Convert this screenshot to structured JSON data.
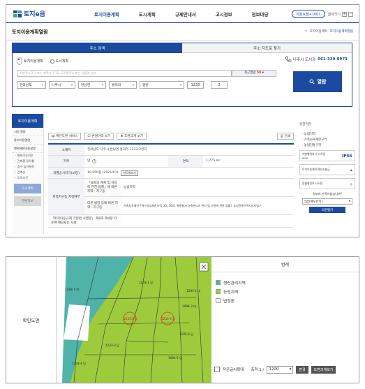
{
  "header": {
    "logo": "토지e음",
    "nav": [
      "토지이용계획",
      "도시계획",
      "규제안내서",
      "고시정보",
      "정보마당"
    ],
    "guide_pill": "지원요청+100?",
    "font_label": "글자크기",
    "plus": "+",
    "minus": "-"
  },
  "title": "토지이용계획열람",
  "breadcrumb": [
    "⌂",
    "토지이용계획",
    "토지이용계획열람"
  ],
  "search": {
    "tabs": [
      "주소 검색",
      "주소 지도로 찾기"
    ],
    "radios": [
      "토지이용계획",
      "도시계획"
    ],
    "phone_label": "나주시 도시과",
    "phone_number": "061-339-8973",
    "address_placeholder": "지번주소 1-1 또는 제주시 1-11, 도로명주소 또는 건물명 입력",
    "recent_label": "최근열람",
    "recent_badge": "58",
    "selects": [
      "전라남도",
      "나주시",
      "반남면",
      "흥덕리",
      "일반"
    ],
    "bon": "1233",
    "bu": "2",
    "dash": "-",
    "view_button": "열람"
  },
  "left_menu": {
    "head": "토지이용계획",
    "items": [
      "시험 열람",
      "통지이용열람",
      "행위제한내용설명"
    ],
    "sub_items": [
      "· 행위가능여부",
      "· 건폐율·용적률",
      "· 층수·높이제한",
      "· 건축선",
      "· 도로조건"
    ],
    "blue_button": "도시계획",
    "gray_button": "관련정보"
  },
  "content": {
    "buttons": [
      "확인도면 서비스",
      "변경이력 보기",
      "도면크게 보기"
    ],
    "print": "인쇄",
    "rows": {
      "location_label": "소재지",
      "location_value": "전라남도 나주시 반남면 흥덕리 1233-2번지",
      "jimok_label": "지목",
      "jimok_value": "답",
      "area_label": "면적",
      "area_value": "1,775 m²",
      "price_label": "개별공시지가(㎡당)",
      "price_value": "10,500원 (2021/01)",
      "price_badge": "연도별보기",
      "zone_label": "지역지구등 지정여부",
      "zone_law1": "「국토의 계획 및 이용에 관한 법률」에 따른 지역 · 지구등",
      "zone_val1": "농림지역",
      "zone_law2": "다른 법령 등에 따른 지역 · 지구등",
      "zone_val2": "가축사육제한구역<일부제한지역_30, 50미, 축종별>(가축분뇨의 관리 및 이용에 관한 법률), 농업진흥구역<농지법>",
      "bottom_label": "「토지이용규제 기본법 시행령」 제9조 제4항 각 호에 해당되는 사항"
    }
  },
  "right_side": {
    "title": "유관기관",
    "links": [
      "· 농림지역",
      "· 가축사육제한구역",
      "· 농업진흥구역"
    ],
    "box1": "개발행위허가 시스템 IPSS",
    "box2": "토지이용계획 확인서발급",
    "box3": "맞춤형정보 시스템",
    "ipss": "IPSS",
    "question": "정보에 만족하셨습니까?",
    "rating": "5점(매우만족)",
    "submit": "의견평가"
  },
  "bottom": {
    "left_label": "확인도면",
    "legend_title": "범례",
    "legend": [
      {
        "label": "생산관리지역",
        "color": "#4fb3a9"
      },
      {
        "label": "농림지역",
        "color": "#9ccc3c"
      },
      {
        "label": "법정동",
        "color": "#ffffff"
      }
    ],
    "small_text_label": "작은글씨확대",
    "scale_label": "축척 1 /",
    "scale_value": "1200",
    "change_button": "변경",
    "big_map_button": "도면크게보기",
    "map_labels": [
      "1183-7 전",
      "1203-1 답",
      "1233-2 답",
      "1233-3 답",
      "1233-4 답",
      "1233-5 답",
      "1203-1 대",
      "1094-1 답",
      "1094-3 대",
      "1205-6 답"
    ]
  }
}
